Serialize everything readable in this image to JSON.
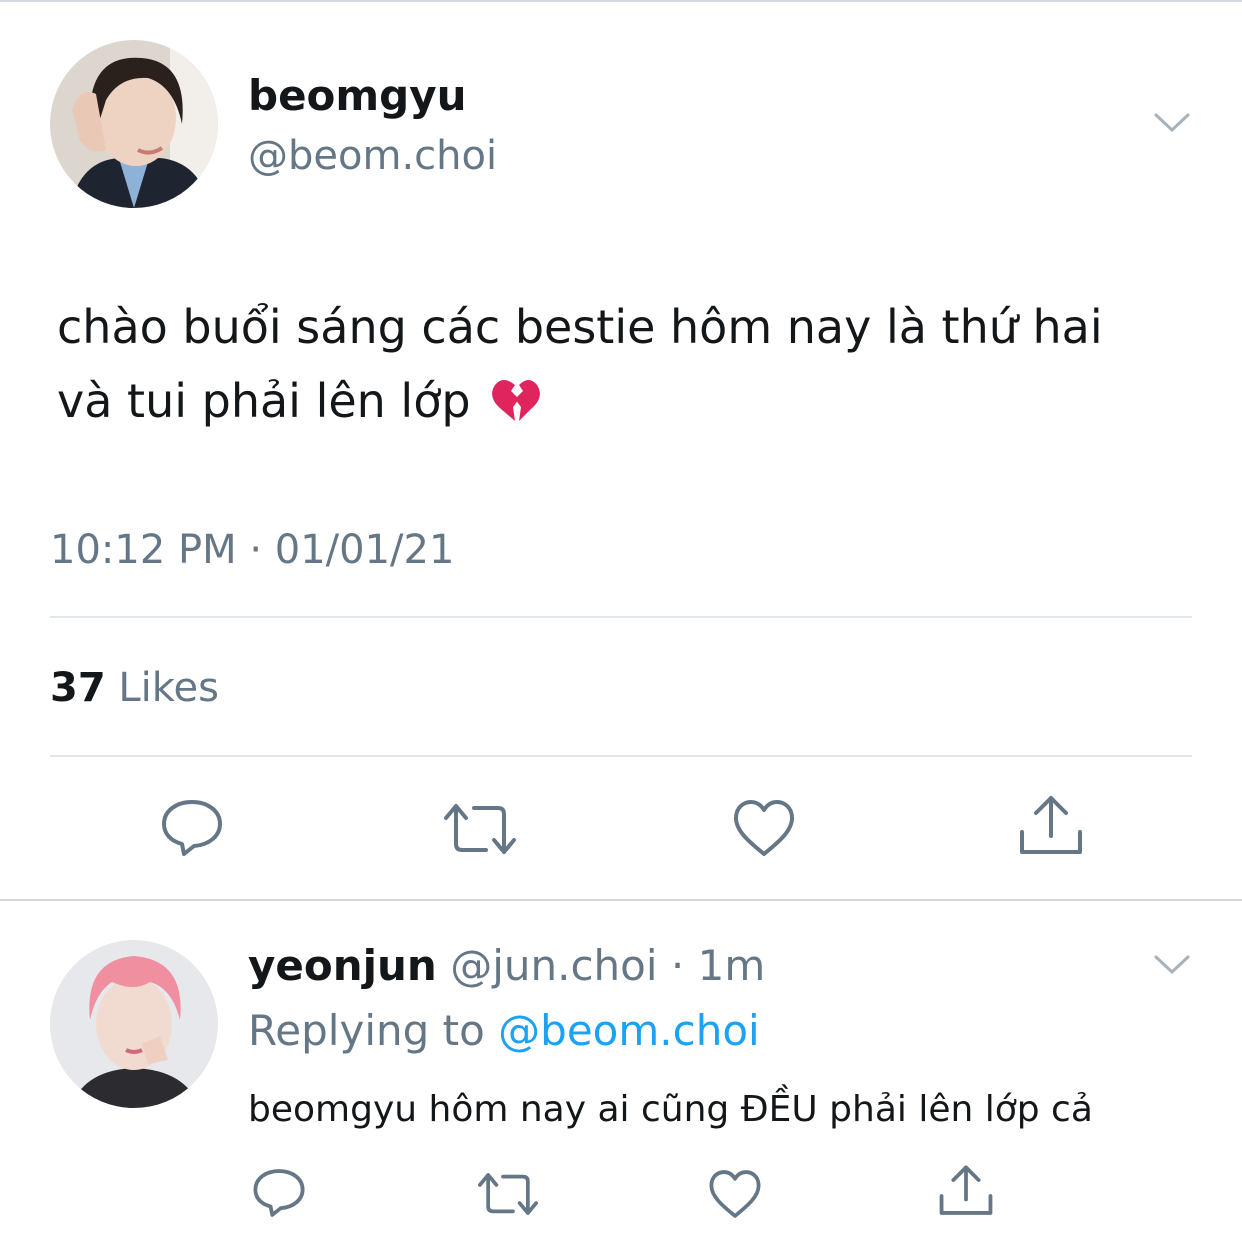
{
  "tweet": {
    "author_name": "beomgyu",
    "author_handle": "@beom.choi",
    "text_line1": "chào buổi sáng các bestie hôm nay là thứ hai",
    "text_line2": "và tui phải lên lớp",
    "emoji": "💔",
    "timestamp": "10:12 PM · 01/01/21",
    "likes_count": "37",
    "likes_label": "Likes",
    "more_icon": "chevron-down-icon",
    "actions": [
      "reply-icon",
      "retweet-icon",
      "like-icon",
      "share-icon"
    ]
  },
  "reply": {
    "author_name": "yeonjun",
    "author_handle": "@jun.choi",
    "time": "· 1m",
    "replying_prefix": "Replying to",
    "replying_handle": "@beom.choi",
    "text": "beomgyu hôm nay ai cũng ĐỀU phải lên lớp cả",
    "actions": [
      "reply-icon",
      "retweet-icon",
      "like-icon",
      "share-icon"
    ]
  },
  "colors": {
    "text": "#14171a",
    "secondary": "#657786",
    "link": "#1da1f2",
    "icon": "#657786",
    "divider": "#e1e6ea"
  }
}
